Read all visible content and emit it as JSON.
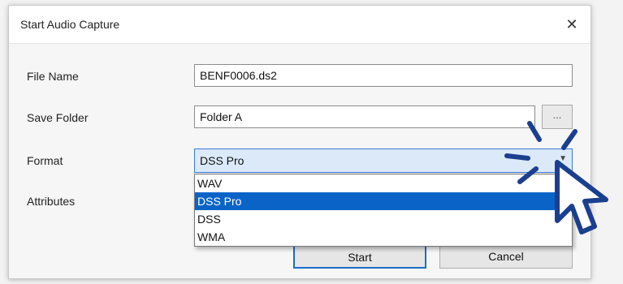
{
  "dialog": {
    "title": "Start Audio Capture",
    "close_glyph": "✕",
    "fields": {
      "file_name_label": "File Name",
      "file_name_value": "BENF0006.ds2",
      "save_folder_label": "Save Folder",
      "save_folder_value": "Folder A",
      "browse_label": "...",
      "format_label": "Format",
      "format_value": "DSS Pro",
      "attributes_label": "Attributes"
    },
    "format_options": [
      "WAV",
      "DSS Pro",
      "DSS",
      "WMA"
    ],
    "buttons": {
      "start": "Start",
      "cancel": "Cancel"
    }
  },
  "colors": {
    "selection": "#0a64c8",
    "focus_border": "#3a7bd5",
    "cursor_accent": "#1b3f8f"
  },
  "icons": {
    "pointer": "click-pointer-icon",
    "caret": "chevron-down-icon",
    "close": "close-icon"
  }
}
